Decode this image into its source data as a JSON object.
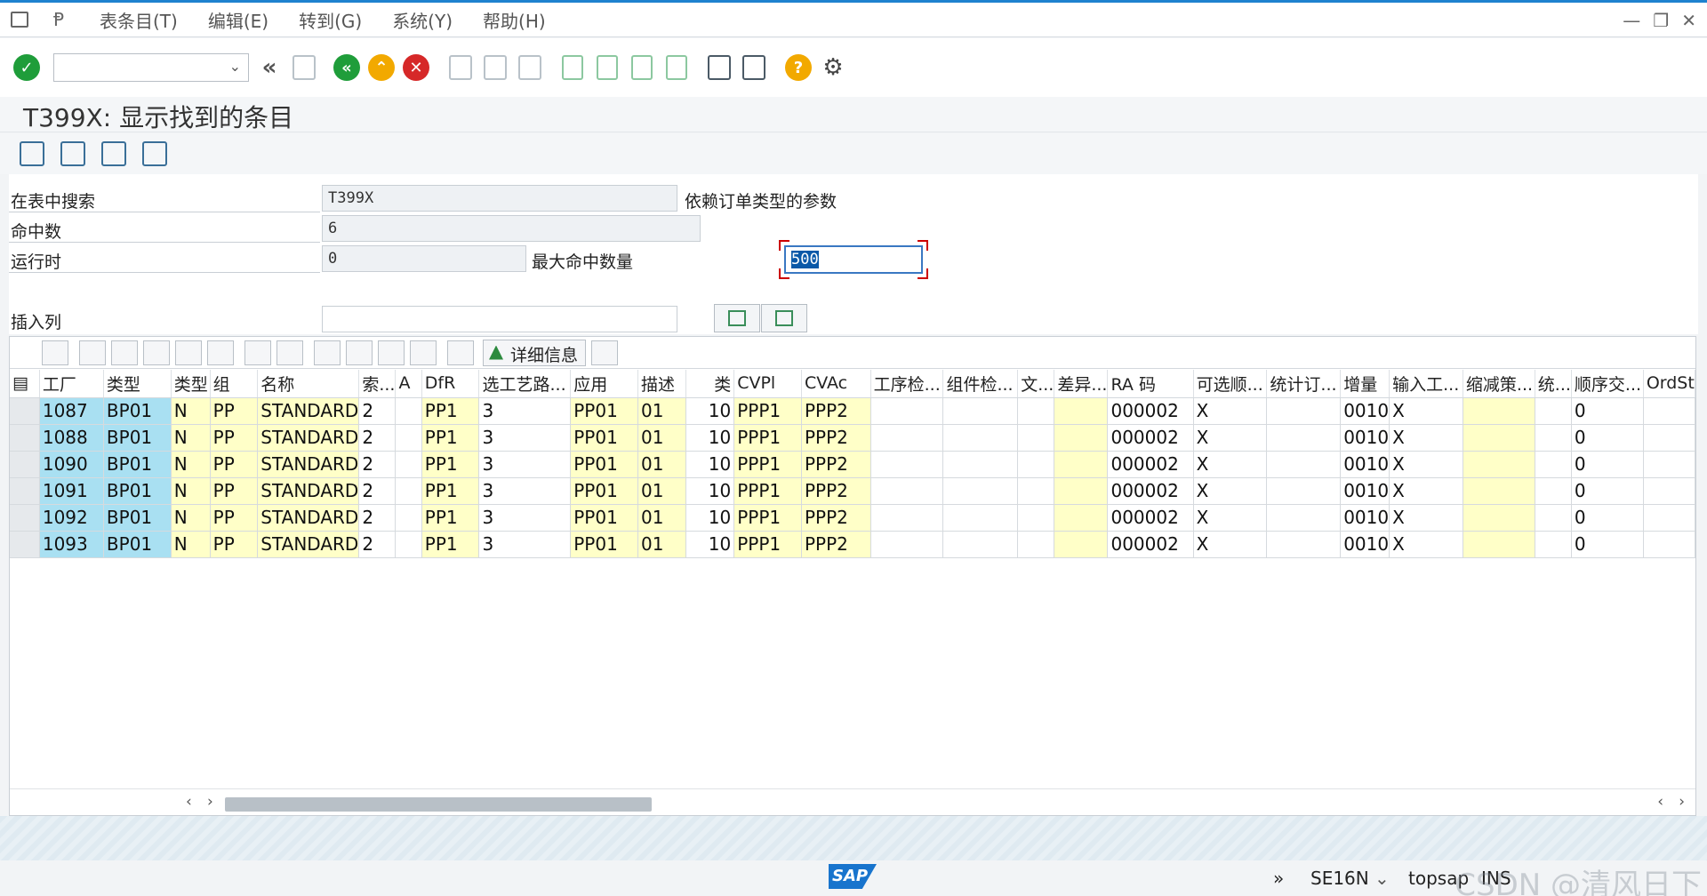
{
  "menu": {
    "items": [
      "表条目(T)",
      "编辑(E)",
      "转到(G)",
      "系统(Y)",
      "帮助(H)"
    ]
  },
  "toolbar": {
    "command_value": "",
    "icons": [
      "enter-icon",
      "back-double-icon",
      "save-icon",
      "back-icon",
      "exit-icon",
      "cancel-icon",
      "print-icon",
      "find-icon",
      "find-next-icon",
      "first-page-icon",
      "prev-page-icon",
      "next-page-icon",
      "last-page-icon",
      "new-session-icon",
      "shortcut-icon",
      "help-icon",
      "customize-icon"
    ],
    "colors": {
      "enter": "#1f9d3a",
      "back": "#1f9d3a",
      "exit": "#f2a900",
      "cancel": "#d62828",
      "help": "#f2a900"
    }
  },
  "title": "T399X: 显示找到的条目",
  "form": {
    "search_table_label": "在表中搜索",
    "search_table_value": "T399X",
    "search_table_desc": "依赖订单类型的参数",
    "hits_label": "命中数",
    "hits_value": "6",
    "runtime_label": "运行时",
    "runtime_value": "0",
    "max_hits_label": "最大命中数量",
    "max_hits_value": "500",
    "insert_col_label": "插入列",
    "insert_col_value": ""
  },
  "grid": {
    "detail_label": "详细信息",
    "columns": [
      "工厂",
      "类型",
      "类型",
      "组",
      "名称",
      "索...",
      "A",
      "DfR",
      "选工艺路...",
      "应用",
      "描述",
      "类",
      "CVPl",
      "CVAc",
      "工序检...",
      "组件检...",
      "文...",
      "差异...",
      "RA 码",
      "可选顺...",
      "统计订...",
      "增量",
      "输入工...",
      "缩减策...",
      "统...",
      "顺序交...",
      "OrdSt"
    ],
    "rows": [
      [
        "1087",
        "BP01",
        "N",
        "PP",
        "STANDARD",
        "2",
        "",
        "PP1",
        "3",
        "PP01",
        "01",
        "10",
        "PPP1",
        "PPP2",
        "",
        "",
        "",
        "",
        "000002",
        "X",
        "",
        "0010",
        "X",
        "",
        "",
        "0",
        ""
      ],
      [
        "1088",
        "BP01",
        "N",
        "PP",
        "STANDARD",
        "2",
        "",
        "PP1",
        "3",
        "PP01",
        "01",
        "10",
        "PPP1",
        "PPP2",
        "",
        "",
        "",
        "",
        "000002",
        "X",
        "",
        "0010",
        "X",
        "",
        "",
        "0",
        ""
      ],
      [
        "1090",
        "BP01",
        "N",
        "PP",
        "STANDARD",
        "2",
        "",
        "PP1",
        "3",
        "PP01",
        "01",
        "10",
        "PPP1",
        "PPP2",
        "",
        "",
        "",
        "",
        "000002",
        "X",
        "",
        "0010",
        "X",
        "",
        "",
        "0",
        ""
      ],
      [
        "1091",
        "BP01",
        "N",
        "PP",
        "STANDARD",
        "2",
        "",
        "PP1",
        "3",
        "PP01",
        "01",
        "10",
        "PPP1",
        "PPP2",
        "",
        "",
        "",
        "",
        "000002",
        "X",
        "",
        "0010",
        "X",
        "",
        "",
        "0",
        ""
      ],
      [
        "1092",
        "BP01",
        "N",
        "PP",
        "STANDARD",
        "2",
        "",
        "PP1",
        "3",
        "PP01",
        "01",
        "10",
        "PPP1",
        "PPP2",
        "",
        "",
        "",
        "",
        "000002",
        "X",
        "",
        "0010",
        "X",
        "",
        "",
        "0",
        ""
      ],
      [
        "1093",
        "BP01",
        "N",
        "PP",
        "STANDARD",
        "2",
        "",
        "PP1",
        "3",
        "PP01",
        "01",
        "10",
        "PPP1",
        "PPP2",
        "",
        "",
        "",
        "",
        "000002",
        "X",
        "",
        "0010",
        "X",
        "",
        "",
        "0",
        ""
      ]
    ]
  },
  "status": {
    "transaction": "SE16N",
    "server": "topsap",
    "mode": "INS",
    "watermark": "CSDN @清风日下",
    "logo_text": "SAP"
  }
}
